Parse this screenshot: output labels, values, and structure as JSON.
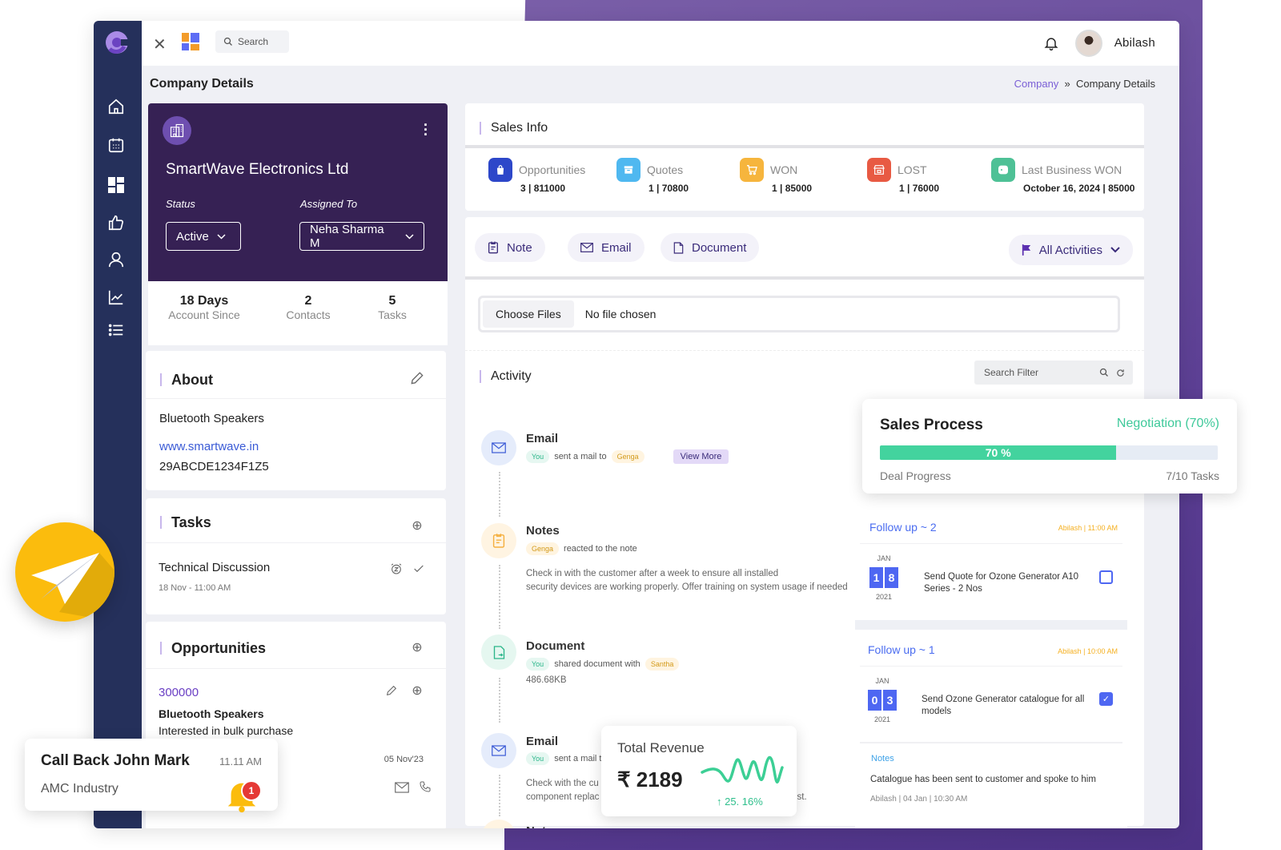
{
  "topbar": {
    "search_placeholder": "Search",
    "user_name": "Abilash"
  },
  "page": {
    "title": "Company Details",
    "breadcrumb": [
      "Company",
      "»",
      "Company Details"
    ]
  },
  "sidebar": {
    "items": [
      "home",
      "calendar",
      "dashboard",
      "deals",
      "contacts",
      "reports",
      "list"
    ]
  },
  "company": {
    "name": "SmartWave Electronics Ltd",
    "status_label": "Status",
    "status_value": "Active",
    "assigned_label": "Assigned To",
    "assigned_value": "Neha Sharma M",
    "stats": [
      {
        "value": "18 Days",
        "label": "Account Since"
      },
      {
        "value": "2",
        "label": "Contacts"
      },
      {
        "value": "5",
        "label": "Tasks"
      }
    ]
  },
  "about": {
    "title": "About",
    "category": "Bluetooth Speakers",
    "website": "www.smartwave.in",
    "gstin": "29ABCDE1234F1Z5"
  },
  "tasks": {
    "title": "Tasks",
    "items": [
      {
        "name": "Technical Discussion",
        "when": "18 Nov - 11:00 AM"
      }
    ]
  },
  "opportunities": {
    "title": "Opportunities",
    "items": [
      {
        "amount": "300000",
        "product": "Bluetooth Speakers",
        "note": "Interested in bulk purchase",
        "date": "05 Nov'23"
      }
    ]
  },
  "sales_info": {
    "title": "Sales Info",
    "items": [
      {
        "label": "Opportunities",
        "value": "3 | 811000",
        "color": "#2d47c9"
      },
      {
        "label": "Quotes",
        "value": "1 | 70800",
        "color": "#4fb8f0"
      },
      {
        "label": "WON",
        "value": "1 | 85000",
        "color": "#f6b53d"
      },
      {
        "label": "LOST",
        "value": "1 | 76000",
        "color": "#e85a43"
      },
      {
        "label": "Last Business WON",
        "value": "October 16, 2024 | 85000",
        "color": "#4ec196"
      }
    ]
  },
  "activity_actions": {
    "note": "Note",
    "email": "Email",
    "document": "Document",
    "filter": "All Activities"
  },
  "file_input": {
    "button": "Choose Files",
    "status": "No file chosen"
  },
  "activity": {
    "title": "Activity",
    "search_placeholder": "Search Filter",
    "items": [
      {
        "type": "Email",
        "actor": "You",
        "action": "sent a mail to",
        "target": "Genga",
        "button": "View More"
      },
      {
        "type": "Notes",
        "actor": "Genga",
        "action": "reacted to the note",
        "body1": "Check in with the customer after a week to ensure all installed",
        "body2": "security devices are working properly. Offer training on system usage if needed"
      },
      {
        "type": "Document",
        "actor": "You",
        "action": "shared document with",
        "target": "Santha",
        "size": "486.68KB"
      },
      {
        "type": "Email",
        "actor": "You",
        "action": "sent a mail t",
        "body1": "Check with the cu",
        "body2": "component replac",
        "body_tail": "ist."
      },
      {
        "type": "Notes"
      }
    ]
  },
  "sales_process": {
    "title": "Sales Process",
    "stage": "Negotiation (70%)",
    "progress_percent": 70,
    "progress_label": "70 %",
    "footer_label": "Deal Progress",
    "tasks": "7/10 Tasks"
  },
  "followups": [
    {
      "title": "Follow up ~ 2",
      "meta": "Abilash | 11:00 AM",
      "month": "JAN",
      "day": [
        "1",
        "8"
      ],
      "year": "2021",
      "text": "Send Quote for Ozone Generator A10 Series - 2 Nos",
      "done": false
    },
    {
      "title": "Follow up ~ 1",
      "meta": "Abilash | 10:00 AM",
      "month": "JAN",
      "day": [
        "0",
        "3"
      ],
      "year": "2021",
      "text": "Send Ozone Generator catalogue for all models",
      "done": true,
      "notes_label": "Notes",
      "note": "Catalogue has been sent to customer and spoke to him",
      "note_meta": "Abilash | 04 Jan | 10:30 AM"
    }
  ],
  "revenue": {
    "title": "Total Revenue",
    "value": "₹ 2189",
    "change": "↑ 25. 16%"
  },
  "call": {
    "title": "Call Back John Mark",
    "time": "11.11 AM",
    "company": "AMC Industry",
    "badge": "1"
  }
}
